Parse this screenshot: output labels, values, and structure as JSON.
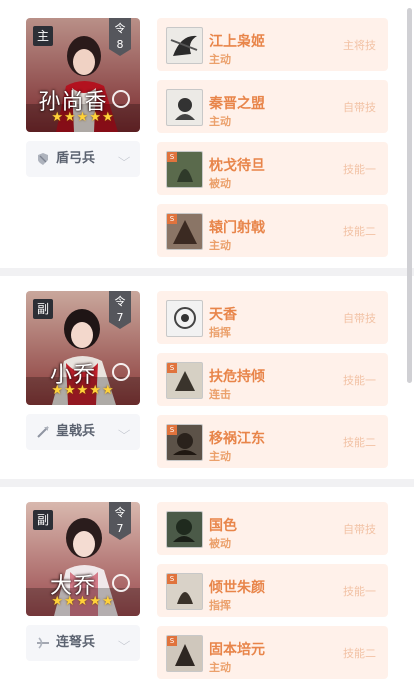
{
  "generals": [
    {
      "role": "主",
      "order_label": "令",
      "order": "8",
      "name": "孙尚香",
      "stars": "★★★★★",
      "troop": "盾弓兵",
      "troop_icon": "shield-bow-icon",
      "skills": [
        {
          "name": "江上枭姬",
          "type": "主动",
          "slot": "主将技",
          "level_badge": ""
        },
        {
          "name": "秦晋之盟",
          "type": "主动",
          "slot": "自带技",
          "level_badge": ""
        },
        {
          "name": "枕戈待旦",
          "type": "被动",
          "slot": "技能一",
          "level_badge": "S"
        },
        {
          "name": "辕门射戟",
          "type": "主动",
          "slot": "技能二",
          "level_badge": "S"
        }
      ]
    },
    {
      "role": "副",
      "order_label": "令",
      "order": "7",
      "name": "小乔",
      "stars": "★★★★★",
      "troop": "皇戟兵",
      "troop_icon": "halberd-icon",
      "skills": [
        {
          "name": "天香",
          "type": "指挥",
          "slot": "自带技",
          "level_badge": ""
        },
        {
          "name": "扶危持倾",
          "type": "连击",
          "slot": "技能一",
          "level_badge": "S"
        },
        {
          "name": "移祸江东",
          "type": "主动",
          "slot": "技能二",
          "level_badge": "S"
        }
      ]
    },
    {
      "role": "副",
      "order_label": "令",
      "order": "7",
      "name": "大乔",
      "stars": "★★★★★",
      "troop": "连弩兵",
      "troop_icon": "crossbow-icon",
      "skills": [
        {
          "name": "国色",
          "type": "被动",
          "slot": "自带技",
          "level_badge": ""
        },
        {
          "name": "倾世朱颜",
          "type": "指挥",
          "slot": "技能一",
          "level_badge": "S"
        },
        {
          "name": "固本培元",
          "type": "主动",
          "slot": "技能二",
          "level_badge": "S"
        }
      ]
    }
  ],
  "colors": {
    "skill_bg": "#fff1ea",
    "skill_name": "#e8854a",
    "slot_text": "#f2c2a5",
    "badge_bg": "#2c2f36",
    "star": "#ffd23a"
  }
}
